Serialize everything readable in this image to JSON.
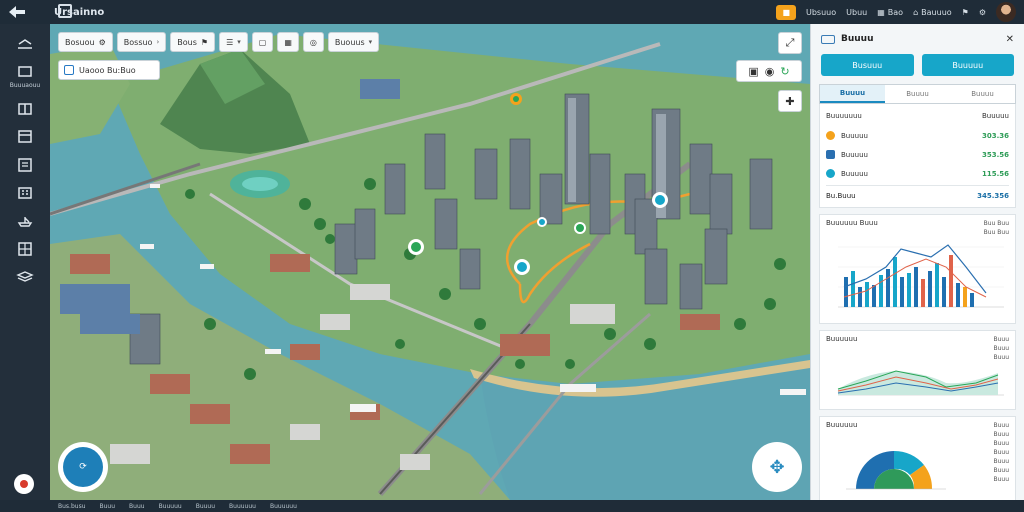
{
  "topbar": {
    "app_title": "Ursainno",
    "accent_label": "",
    "links": [
      "Ubsuuo",
      "Ubuu",
      "Bao",
      "Bauuuo"
    ],
    "colors": {
      "bar": "#1f2c38",
      "accent": "#f4a21c"
    }
  },
  "sidebar": {
    "items": [
      {
        "icon": "layers-icon",
        "label": ""
      },
      {
        "icon": "route-icon",
        "label": "Buuuaouu"
      },
      {
        "icon": "grid-icon",
        "label": ""
      },
      {
        "icon": "window-icon",
        "label": ""
      },
      {
        "icon": "list-icon",
        "label": ""
      },
      {
        "icon": "building-icon",
        "label": ""
      },
      {
        "icon": "ship-icon",
        "label": ""
      },
      {
        "icon": "table-icon",
        "label": ""
      },
      {
        "icon": "stack-icon",
        "label": ""
      }
    ]
  },
  "map": {
    "toolbar": [
      {
        "label": "Bosuou",
        "icon": "gear-icon"
      },
      {
        "label": "Bossuo",
        "icon": "chevron-right-icon"
      },
      {
        "label": "Bous",
        "icon": "pin-icon"
      },
      {
        "label": "",
        "icon": "layers-icon"
      },
      {
        "label": "",
        "icon": "square-icon"
      },
      {
        "label": "",
        "icon": "cube-icon"
      },
      {
        "label": "",
        "icon": "target-icon"
      },
      {
        "label": "Buouus",
        "icon": "chevron-down-icon"
      }
    ],
    "search_label": "Uaooo Bu:Buo",
    "colors": {
      "water": "#5fa8b4",
      "land": "#7aa86a",
      "route": "#f0a030"
    }
  },
  "panel": {
    "title": "Buuuu",
    "buttons": [
      "Busuuu",
      "Buuuuu"
    ],
    "tabs": [
      "Buuuu",
      "Buuuu",
      "Buuuu"
    ],
    "summary": {
      "header_left": "Buuuuuuu",
      "header_right": "Buuuuu",
      "rows": [
        {
          "label": "Buuuuu",
          "value": "303.36",
          "color": "#f4a21c"
        },
        {
          "label": "Buuuuu",
          "value": "353.56",
          "color": "#2a6fb0"
        },
        {
          "label": "Buuuuu",
          "value": "115.56",
          "color": "#17a6c9"
        }
      ],
      "total_label": "Bu.Buuu",
      "total_value": "345.356"
    },
    "chart1": {
      "title": "Buuuuuu Buuu",
      "legend": [
        "Buu Buu",
        "Buu Buu"
      ]
    },
    "chart2": {
      "title": "Buuuuuu",
      "legend": [
        "Buuu",
        "Buuu",
        "Buuu"
      ]
    },
    "chart3": {
      "title": "Buuuuuu",
      "legend": [
        "Buuu",
        "Buuu",
        "Buuu",
        "Buuu",
        "Buuu",
        "Buuu",
        "Buuu"
      ]
    }
  },
  "bottombar": {
    "items": [
      "Bus.busu",
      "Buuu",
      "Buuu",
      "Buuuuu",
      "Buuuu",
      "Buuuuuu",
      "Buuuuuu"
    ]
  }
}
